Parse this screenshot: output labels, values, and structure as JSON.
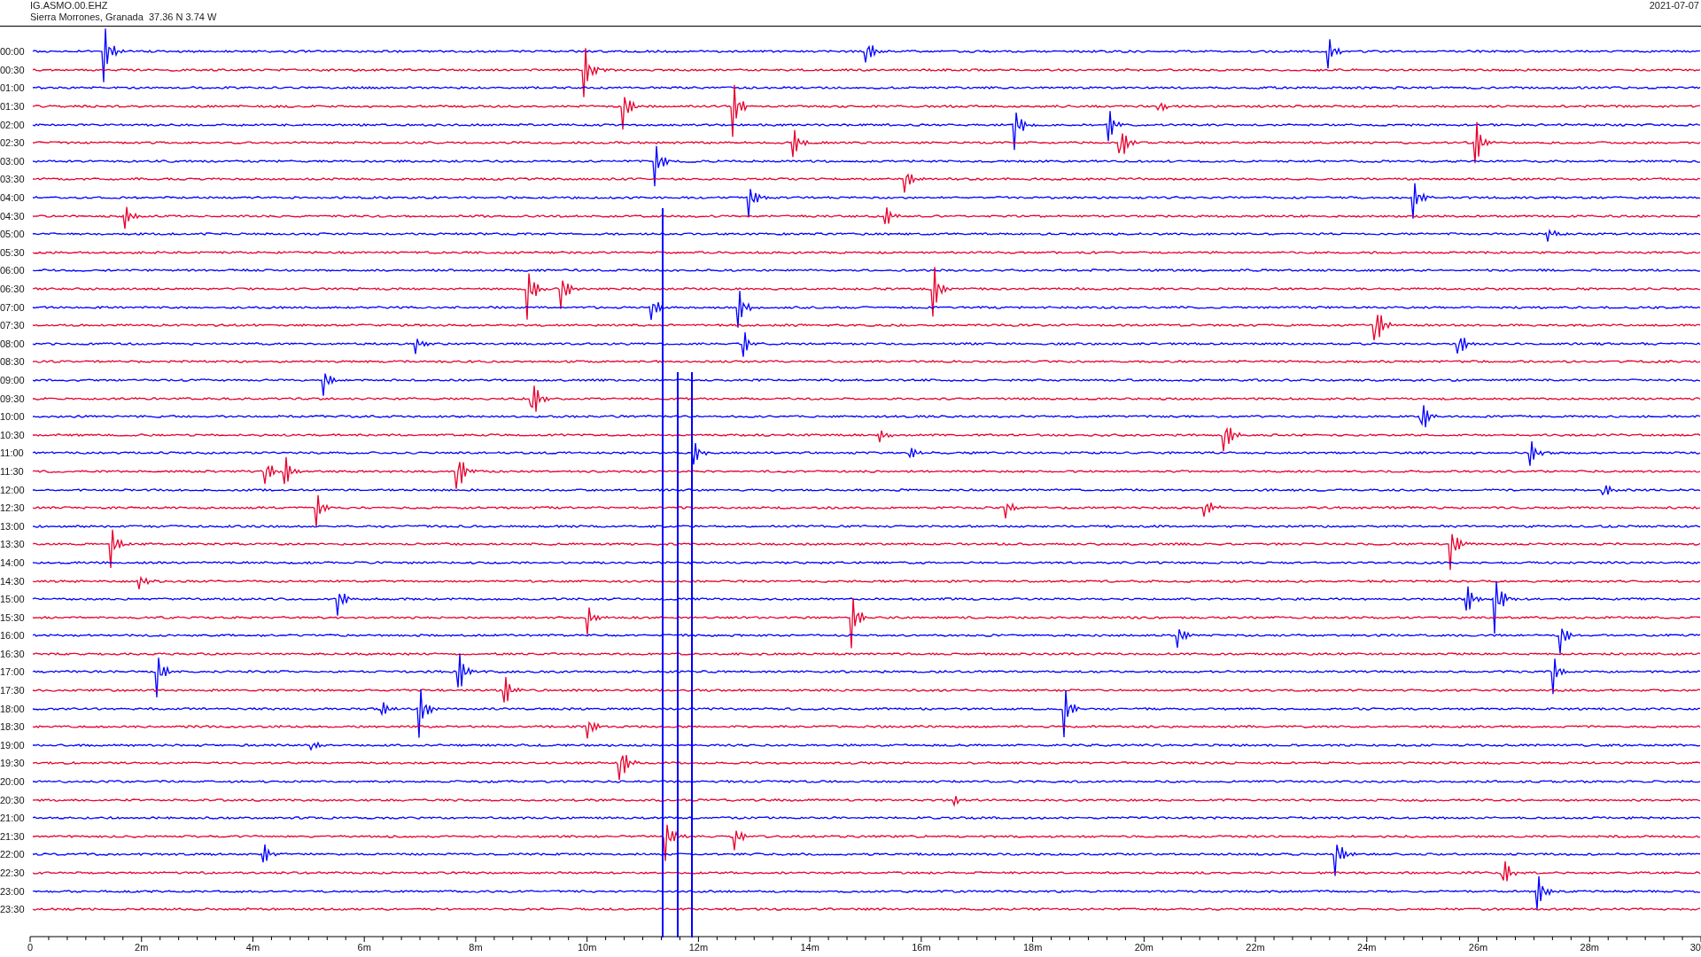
{
  "header": {
    "station": "IG.ASMO.00.EHZ",
    "location": "Sierra Morrones, Granada  37.36 N 3.74 W",
    "date": "2021-07-07"
  },
  "rows": [
    {
      "time": "00:00",
      "color": "#0000ff"
    },
    {
      "time": "00:30",
      "color": "#e6002e"
    },
    {
      "time": "01:00",
      "color": "#0000ff"
    },
    {
      "time": "01:30",
      "color": "#e6002e"
    },
    {
      "time": "02:00",
      "color": "#0000ff"
    },
    {
      "time": "02:30",
      "color": "#e6002e"
    },
    {
      "time": "03:00",
      "color": "#0000ff"
    },
    {
      "time": "03:30",
      "color": "#e6002e"
    },
    {
      "time": "04:00",
      "color": "#0000ff"
    },
    {
      "time": "04:30",
      "color": "#e6002e"
    },
    {
      "time": "05:00",
      "color": "#0000ff"
    },
    {
      "time": "05:30",
      "color": "#e6002e"
    },
    {
      "time": "06:00",
      "color": "#0000ff"
    },
    {
      "time": "06:30",
      "color": "#e6002e"
    },
    {
      "time": "07:00",
      "color": "#0000ff"
    },
    {
      "time": "07:30",
      "color": "#e6002e"
    },
    {
      "time": "08:00",
      "color": "#0000ff"
    },
    {
      "time": "08:30",
      "color": "#e6002e"
    },
    {
      "time": "09:00",
      "color": "#0000ff"
    },
    {
      "time": "09:30",
      "color": "#e6002e"
    },
    {
      "time": "10:00",
      "color": "#0000ff"
    },
    {
      "time": "10:30",
      "color": "#e6002e"
    },
    {
      "time": "11:00",
      "color": "#0000ff"
    },
    {
      "time": "11:30",
      "color": "#e6002e"
    },
    {
      "time": "12:00",
      "color": "#0000ff"
    },
    {
      "time": "12:30",
      "color": "#e6002e"
    },
    {
      "time": "13:00",
      "color": "#0000ff"
    },
    {
      "time": "13:30",
      "color": "#e6002e"
    },
    {
      "time": "14:00",
      "color": "#0000ff"
    },
    {
      "time": "14:30",
      "color": "#e6002e"
    },
    {
      "time": "15:00",
      "color": "#0000ff"
    },
    {
      "time": "15:30",
      "color": "#e6002e"
    },
    {
      "time": "16:00",
      "color": "#0000ff"
    },
    {
      "time": "16:30",
      "color": "#e6002e"
    },
    {
      "time": "17:00",
      "color": "#0000ff"
    },
    {
      "time": "17:30",
      "color": "#e6002e"
    },
    {
      "time": "18:00",
      "color": "#0000ff"
    },
    {
      "time": "18:30",
      "color": "#e6002e"
    },
    {
      "time": "19:00",
      "color": "#0000ff"
    },
    {
      "time": "19:30",
      "color": "#e6002e"
    },
    {
      "time": "20:00",
      "color": "#0000ff"
    },
    {
      "time": "20:30",
      "color": "#e6002e"
    },
    {
      "time": "21:00",
      "color": "#0000ff"
    },
    {
      "time": "21:30",
      "color": "#e6002e"
    },
    {
      "time": "22:00",
      "color": "#0000ff"
    },
    {
      "time": "22:30",
      "color": "#e6002e"
    },
    {
      "time": "23:00",
      "color": "#0000ff"
    },
    {
      "time": "23:30",
      "color": "#e6002e"
    }
  ],
  "time_axis": {
    "labels": [
      "0",
      "2m",
      "4m",
      "6m",
      "8m",
      "10m",
      "12m",
      "14m",
      "16m",
      "18m",
      "20m",
      "22m",
      "24m",
      "26m",
      "28m",
      "30"
    ]
  }
}
